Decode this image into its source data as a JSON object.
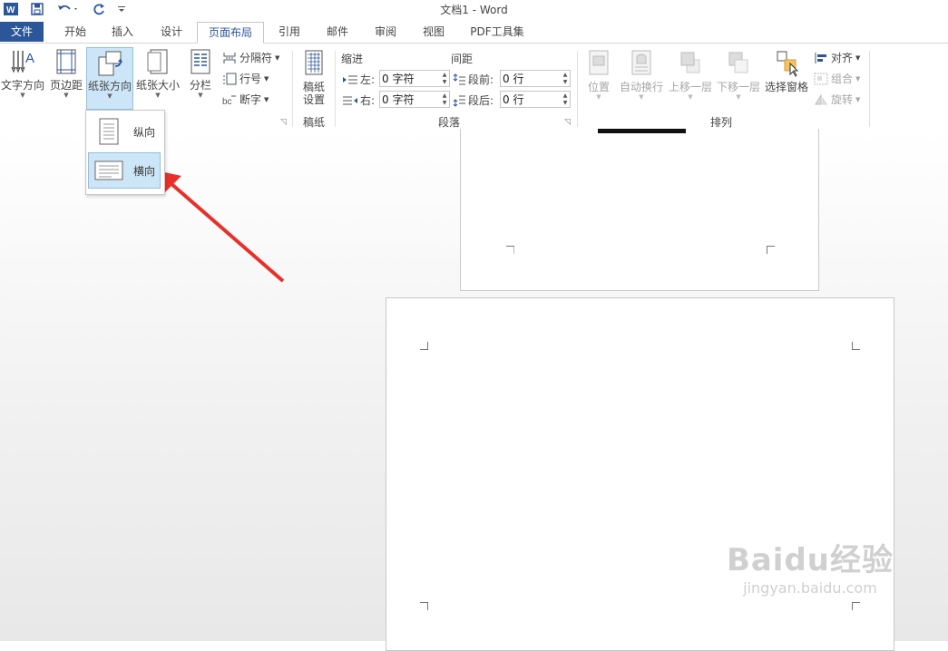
{
  "window": {
    "title": "文档1 - Word"
  },
  "tabs": [
    {
      "label": "文件"
    },
    {
      "label": "开始"
    },
    {
      "label": "插入"
    },
    {
      "label": "设计"
    },
    {
      "label": "页面布局"
    },
    {
      "label": "引用"
    },
    {
      "label": "邮件"
    },
    {
      "label": "审阅"
    },
    {
      "label": "视图"
    },
    {
      "label": "PDF工具集"
    }
  ],
  "ribbon": {
    "page_setup": {
      "text_direction": "文字方向",
      "margins": "页边距",
      "orientation": "纸张方向",
      "size": "纸张大小",
      "columns": "分栏",
      "breaks": "分隔符",
      "line_numbers": "行号",
      "hyphenation": "断字"
    },
    "manuscript": {
      "settings_line1": "稿纸",
      "settings_line2": "设置",
      "group_label": "稿纸"
    },
    "paragraph": {
      "indent_header": "缩进",
      "spacing_header": "间距",
      "left_label": "左:",
      "right_label": "右:",
      "before_label": "段前:",
      "after_label": "段后:",
      "left_value": "0 字符",
      "right_value": "0 字符",
      "before_value": "0 行",
      "after_value": "0 行",
      "group_label": "段落"
    },
    "arrange": {
      "position": "位置",
      "wrap_text": "自动换行",
      "bring_forward": "上移一层",
      "send_backward": "下移一层",
      "selection_pane": "选择窗格",
      "align": "对齐",
      "group": "组合",
      "rotate": "旋转",
      "group_label": "排列"
    }
  },
  "orientation_menu": {
    "portrait": "纵向",
    "landscape": "横向"
  },
  "watermark": {
    "brand": "Baidu经验",
    "url": "jingyan.baidu.com"
  },
  "colors": {
    "accent": "#2b579a",
    "arrow": "#e8302a",
    "hover": "#cde6f7"
  }
}
